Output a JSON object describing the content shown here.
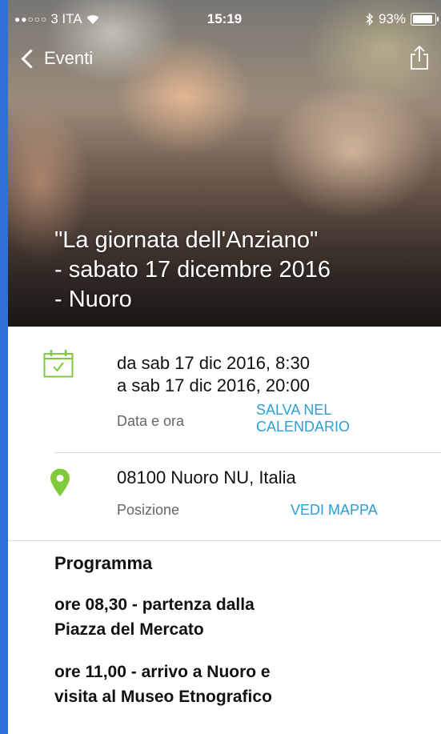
{
  "status_bar": {
    "carrier": "3 ITA",
    "time": "15:19",
    "battery": "93%",
    "battery_level": 0.93,
    "signal_dots": "●●○○○"
  },
  "nav": {
    "back_label": "Eventi"
  },
  "event": {
    "title_lines": [
      "\"La giornata dell'Anziano\"",
      "- sabato 17 dicembre 2016",
      "- Nuoro"
    ]
  },
  "date_section": {
    "from": "da sab 17 dic 2016, 8:30",
    "to": "a sab 17 dic 2016, 20:00",
    "label": "Data e ora",
    "action_line1": "SALVA NEL",
    "action_line2": "CALENDARIO",
    "icon": "calendar-icon"
  },
  "location_section": {
    "address": "08100 Nuoro NU, Italia",
    "label": "Posizione",
    "action": "VEDI MAPPA",
    "icon": "location-pin-icon"
  },
  "program": {
    "heading": "Programma",
    "items": [
      [
        "ore 08,30 - partenza dalla",
        "Piazza del Mercato"
      ],
      [
        "ore 11,00 - arrivo a Nuoro e",
        "visita al Museo Etnografico"
      ]
    ]
  },
  "colors": {
    "accent": "#2a9fd8",
    "icon_green": "#7fc93b",
    "outer_frame": "#2f6fd6"
  }
}
